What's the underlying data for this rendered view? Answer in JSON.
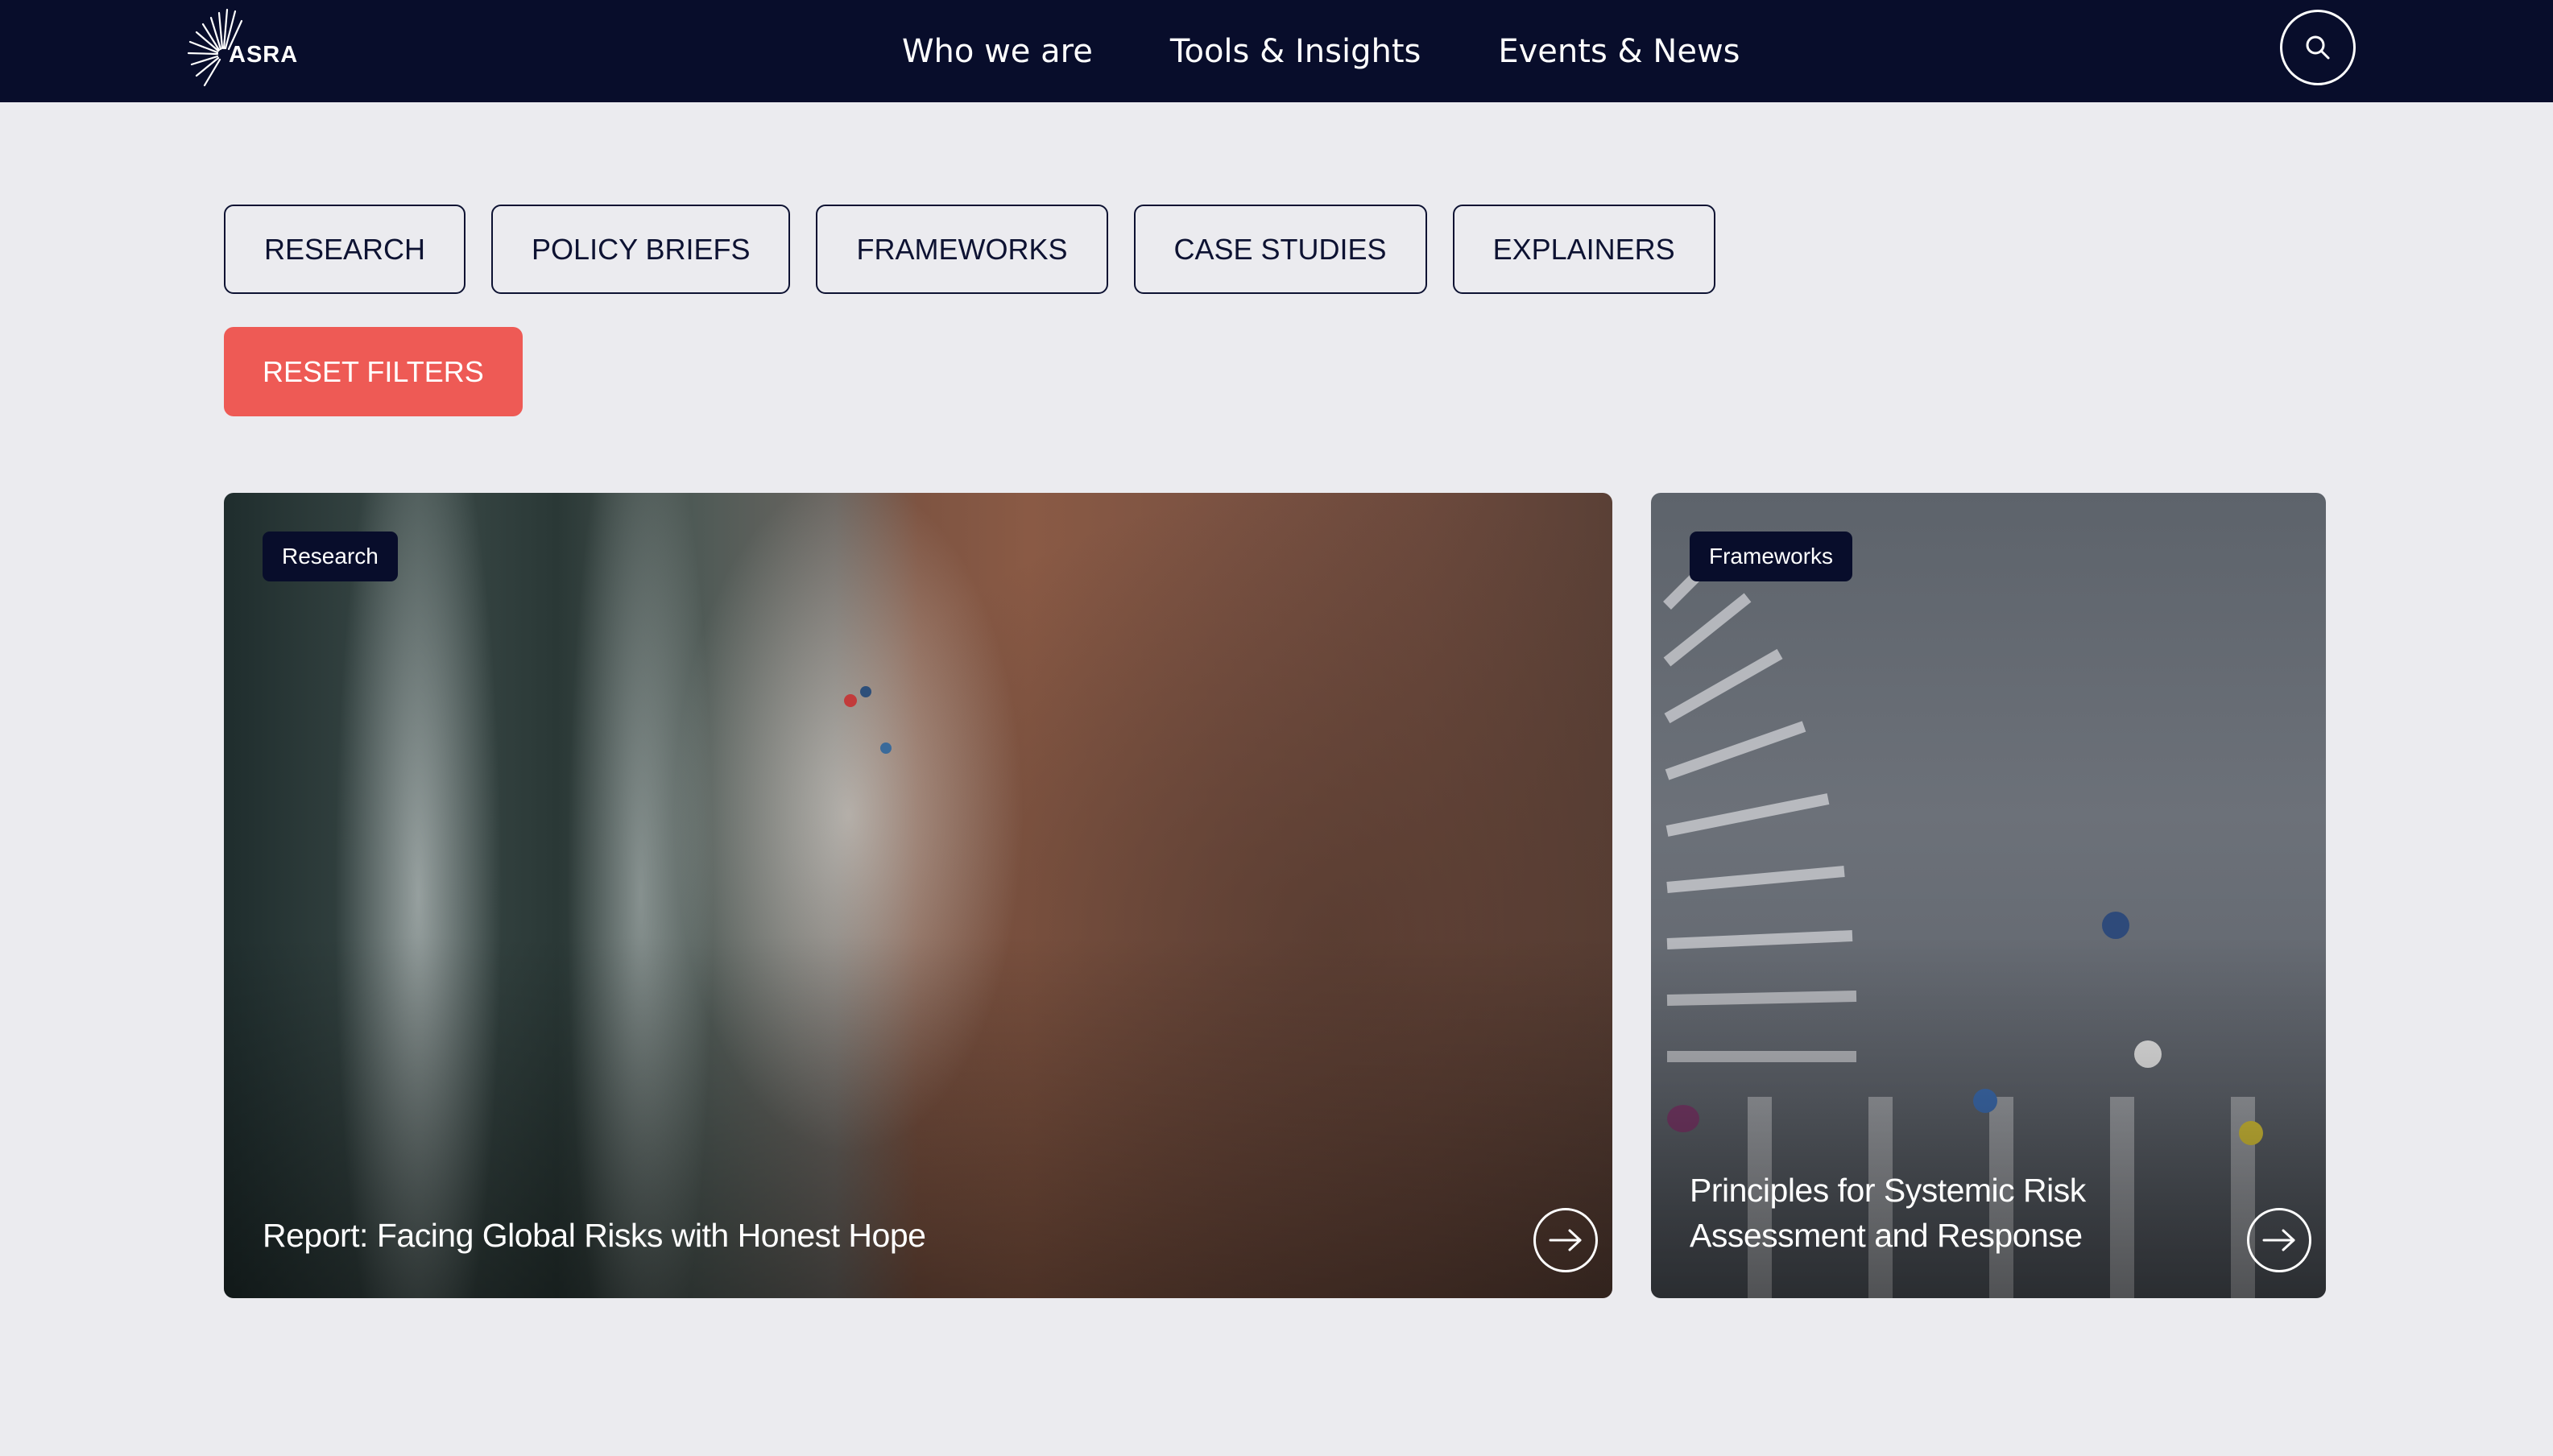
{
  "header": {
    "logo_text": "ASRA",
    "nav": [
      "Who we are",
      "Tools & Insights",
      "Events & News"
    ],
    "search_icon": "search-icon"
  },
  "filters": {
    "items": [
      "RESEARCH",
      "POLICY BRIEFS",
      "FRAMEWORKS",
      "CASE STUDIES",
      "EXPLAINERS"
    ],
    "reset_label": "RESET FILTERS"
  },
  "cards": [
    {
      "badge": "Research",
      "title": "Report: Facing Global Risks with Honest Hope",
      "image": "aerial-beach-waves",
      "arrow_icon": "arrow-right-icon"
    },
    {
      "badge": "Frameworks",
      "title": "Principles for Systemic Risk Assessment and Response",
      "image": "aerial-crosswalk-pedestrians",
      "arrow_icon": "arrow-right-icon"
    }
  ],
  "colors": {
    "header_bg": "#080d2b",
    "page_bg": "#ebebef",
    "accent_reset": "#ee5a55",
    "badge_bg": "#080d2b",
    "text_dark": "#0d1232"
  }
}
